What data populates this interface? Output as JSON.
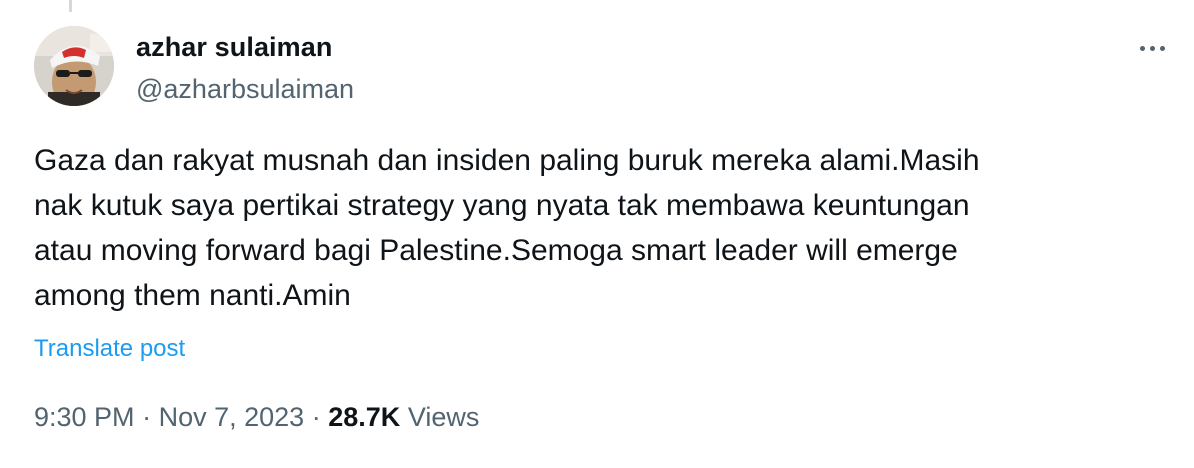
{
  "author": {
    "display_name": "azhar sulaiman",
    "handle": "@azharbsulaiman",
    "avatar_icon": "profile-photo"
  },
  "post": {
    "text": "Gaza dan rakyat musnah dan insiden paling buruk mereka alami.Masih\nnak kutuk saya pertikai strategy yang nyata tak membawa keuntungan\natau moving forward bagi Palestine.Semoga smart leader will emerge\namong them nanti.Amin",
    "translate_label": "Translate post"
  },
  "meta": {
    "time": "9:30 PM",
    "separator": "·",
    "date": "Nov 7, 2023",
    "views_count": "28.7K",
    "views_label": "Views"
  },
  "colors": {
    "text_primary": "#0f1419",
    "text_secondary": "#536471",
    "link": "#1d9bf0"
  }
}
